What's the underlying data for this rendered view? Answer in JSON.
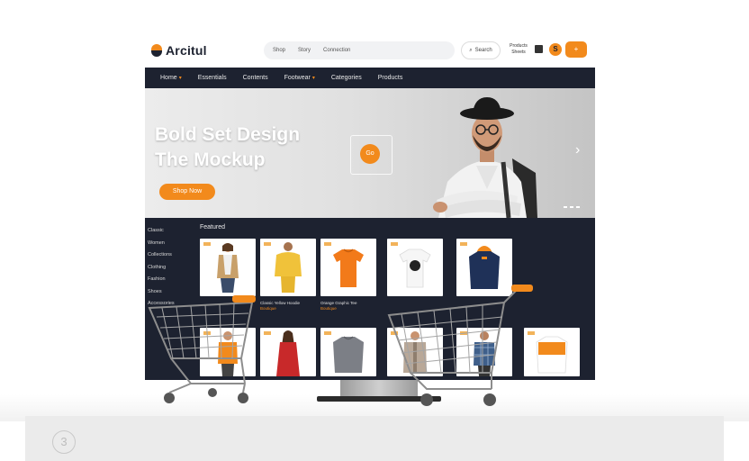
{
  "brand": {
    "name": "Arcitul"
  },
  "header": {
    "search_links": [
      "Shop",
      "Story",
      "Connection"
    ],
    "search_label": "Search",
    "account_lines": [
      "Products",
      "Sheets"
    ],
    "round_button": "S",
    "orange_button": "+"
  },
  "nav": {
    "items": [
      "Home",
      "Essentials",
      "Contents",
      "Footwear",
      "Categories",
      "Products"
    ],
    "dropdown_items": [
      0,
      3
    ]
  },
  "hero": {
    "title_line1": "Bold Set Design",
    "title_line2": "The Mockup",
    "cta": "Shop Now",
    "play_label": "Go",
    "next_glyph": "›"
  },
  "sidebar": {
    "items": [
      "Classic",
      "Women",
      "Collections",
      "Clothing",
      "Fashion",
      "Shoes",
      "Accessories"
    ]
  },
  "products": {
    "section_title": "Featured",
    "row1": [
      {
        "kind": "woman-jacket",
        "caption": []
      },
      {
        "kind": "man-yellow",
        "caption": [
          "Classic Yellow Hoodie",
          "Boutique"
        ]
      },
      {
        "kind": "orange-tee",
        "caption": [
          "Orange Graphic Tee",
          "Boutique"
        ]
      },
      {
        "kind": "white-tee",
        "caption": []
      },
      {
        "kind": "navy-hoodie",
        "caption": []
      }
    ],
    "row2": [
      {
        "kind": "woman-orange"
      },
      {
        "kind": "woman-red"
      },
      {
        "kind": "grey-sweater"
      },
      {
        "kind": "man-jacket"
      },
      {
        "kind": "man-plaid"
      },
      {
        "kind": "orange-sweater"
      }
    ]
  },
  "footer": {
    "badge": "3"
  },
  "colors": {
    "accent": "#f28a1c",
    "dark": "#1d2230"
  }
}
